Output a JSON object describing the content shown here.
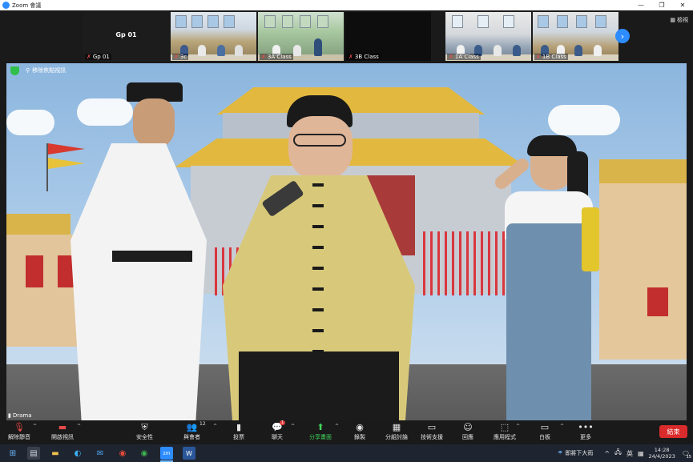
{
  "window": {
    "title": "Zoom 會議",
    "minimize_glyph": "—",
    "restore_glyph": "❐",
    "close_glyph": "✕"
  },
  "strip": {
    "view_label": "檢視",
    "next_icon": "chevron-right-icon",
    "participants": [
      {
        "name": "Gp 01",
        "type": "name-only",
        "center_name": "Gp 01"
      },
      {
        "name": "3c",
        "type": "video"
      },
      {
        "name": "3A Class",
        "type": "video"
      },
      {
        "name": "3B Class",
        "type": "blank"
      },
      {
        "name": "1A Class",
        "type": "video"
      },
      {
        "name": "1B Class",
        "type": "video"
      }
    ]
  },
  "main_video": {
    "unpin_label": "移除焦點視訊",
    "speaker_label": "Drama",
    "security_icon": "shield-icon"
  },
  "toolbar": {
    "items": [
      {
        "label": "解除靜音",
        "icon": "mic-muted-icon"
      },
      {
        "label": "開啟視訊",
        "icon": "video-off-icon"
      },
      {
        "label": "安全性",
        "icon": "shield-icon"
      },
      {
        "label": "與會者",
        "icon": "participants-icon",
        "count": "12"
      },
      {
        "label": "投票",
        "icon": "poll-icon"
      },
      {
        "label": "聊天",
        "icon": "chat-icon",
        "badge": "1"
      },
      {
        "label": "分享畫面",
        "icon": "share-screen-icon"
      },
      {
        "label": "錄製",
        "icon": "record-icon"
      },
      {
        "label": "分組討論",
        "icon": "breakout-icon"
      },
      {
        "label": "技術支援",
        "icon": "support-icon"
      },
      {
        "label": "回應",
        "icon": "reaction-icon"
      },
      {
        "label": "應用程式",
        "icon": "apps-icon"
      },
      {
        "label": "白板",
        "icon": "whiteboard-icon"
      },
      {
        "label": "更多",
        "icon": "more-icon"
      }
    ],
    "end_label": "結束"
  },
  "taskbar": {
    "weather_text": "即將下大雨",
    "lang": "英",
    "time": "14:28",
    "date": "24/4/2023",
    "notifications": "15"
  },
  "colors": {
    "accent": "#2d8cff",
    "share_green": "#3fd35a",
    "end_red": "#d92b2b"
  }
}
